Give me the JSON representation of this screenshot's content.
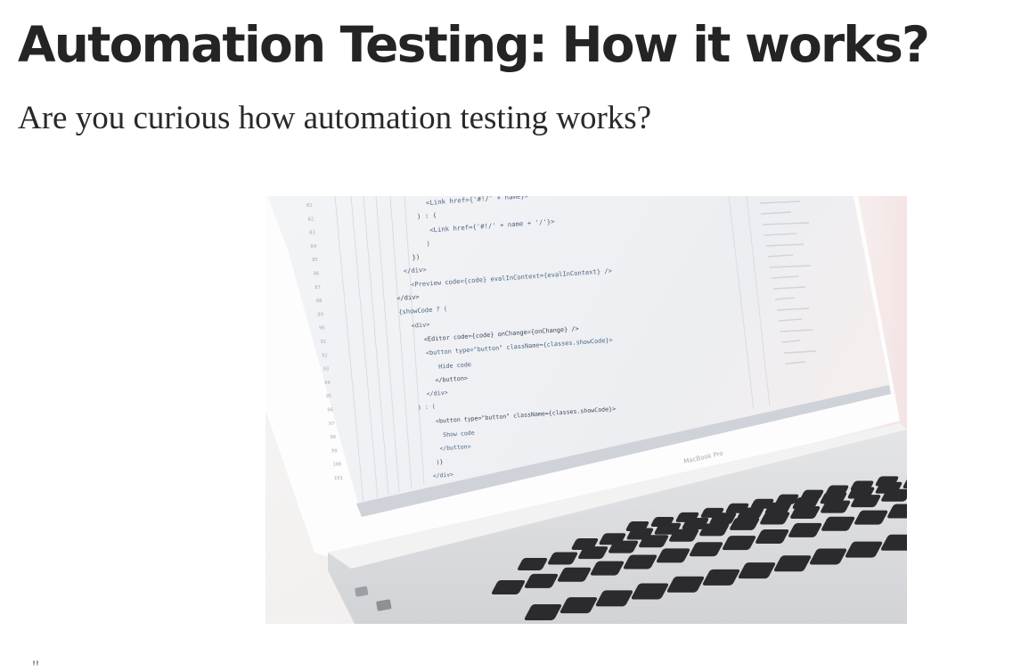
{
  "article": {
    "title": "Automation Testing: How it works?",
    "subtitle": "Are you curious how automation testing works?"
  },
  "hero_image": {
    "depicts": "laptop-with-code",
    "code_lines": [
      "<Link href={'#!/' + name}>",
      ") : (",
      "<Link href={'#!/' + name + '/'}>",
      ")",
      "})",
      "</div>",
      "<Preview code={code} evalInContext={evalInContext} />",
      "</div>",
      "{showCode ? (",
      "<div>",
      "<Editor code={code} onChange={onChange} />",
      "<button type=\"button\" className={classes.showCode}>",
      "Hide code",
      "</button>",
      "</div>",
      ") : (",
      "<button type=\"button\" className={classes.showCode}>",
      "Show code",
      "</button>",
      ")}",
      "</div>"
    ],
    "line_numbers": [
      "81",
      "82",
      "83",
      "84",
      "85",
      "86",
      "87",
      "88",
      "89",
      "90",
      "91",
      "92",
      "93",
      "94",
      "95",
      "96",
      "97",
      "98",
      "99",
      "100",
      "101"
    ],
    "laptop_label": "MacBook Pro"
  },
  "below_fold": {
    "quote_mark": "''"
  },
  "colors": {
    "text_primary": "#242424",
    "text_secondary": "#292929",
    "code_tag": "#5d7fa3",
    "code_attr": "#c98aa0",
    "key": "#2b2b2d"
  }
}
